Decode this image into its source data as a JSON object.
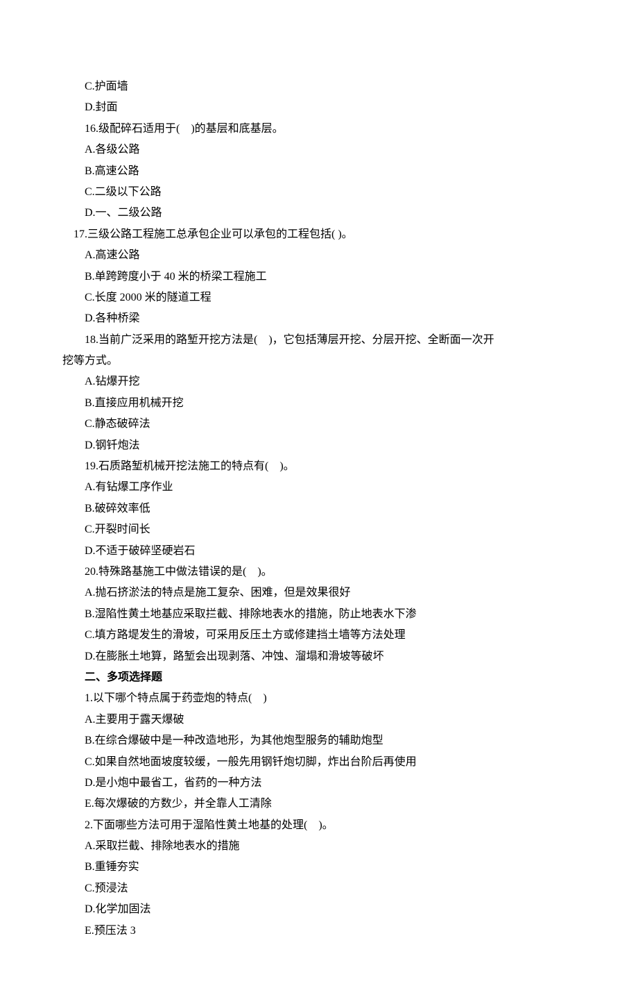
{
  "lines": [
    {
      "cls": "indent-2",
      "key": "q15_c",
      "text": "C.护面墙"
    },
    {
      "cls": "indent-2",
      "key": "q15_d",
      "text": "D.封面"
    },
    {
      "cls": "indent-2",
      "key": "q16_stem",
      "text": "16.级配碎石适用于(　)的基层和底基层。"
    },
    {
      "cls": "indent-2",
      "key": "q16_a",
      "text": "A.各级公路"
    },
    {
      "cls": "indent-2",
      "key": "q16_b",
      "text": "B.高速公路"
    },
    {
      "cls": "indent-2",
      "key": "q16_c",
      "text": "C.二级以下公路"
    },
    {
      "cls": "indent-2",
      "key": "q16_d",
      "text": "D.一、二级公路"
    },
    {
      "cls": "indent-1",
      "key": "q17_stem",
      "text": "17.三级公路工程施工总承包企业可以承包的工程包括( )。"
    },
    {
      "cls": "indent-2",
      "key": "q17_a",
      "text": "A.高速公路"
    },
    {
      "cls": "indent-2",
      "key": "q17_b",
      "text": "B.单跨跨度小于 40 米的桥梁工程施工"
    },
    {
      "cls": "indent-2",
      "key": "q17_c",
      "text": "C.长度 2000 米的隧道工程"
    },
    {
      "cls": "indent-2",
      "key": "q17_d",
      "text": "D.各种桥梁"
    },
    {
      "cls": "indent-2",
      "key": "q18_stem1",
      "text": "18.当前广泛采用的路堑开挖方法是(　)，它包括薄层开挖、分层开挖、全断面一次开"
    },
    {
      "cls": "no-indent",
      "key": "q18_stem2",
      "text": "挖等方式。"
    },
    {
      "cls": "indent-2",
      "key": "q18_a",
      "text": "A.钻爆开挖"
    },
    {
      "cls": "indent-2",
      "key": "q18_b",
      "text": "B.直接应用机械开挖"
    },
    {
      "cls": "indent-2",
      "key": "q18_c",
      "text": "C.静态破碎法"
    },
    {
      "cls": "indent-2",
      "key": "q18_d",
      "text": "D.钢钎炮法"
    },
    {
      "cls": "indent-2",
      "key": "q19_stem",
      "text": "19.石质路堑机械开挖法施工的特点有(　)。"
    },
    {
      "cls": "indent-2",
      "key": "q19_a",
      "text": "A.有钻爆工序作业"
    },
    {
      "cls": "indent-2",
      "key": "q19_b",
      "text": "B.破碎效率低"
    },
    {
      "cls": "indent-2",
      "key": "q19_c",
      "text": "C.开裂时间长"
    },
    {
      "cls": "indent-2",
      "key": "q19_d",
      "text": "D.不适于破碎坚硬岩石"
    },
    {
      "cls": "indent-2",
      "key": "q20_stem",
      "text": "20.特殊路基施工中做法错误的是(　)。"
    },
    {
      "cls": "indent-2",
      "key": "q20_a",
      "text": "A.抛石挤淤法的特点是施工复杂、困难，但是效果很好"
    },
    {
      "cls": "indent-2",
      "key": "q20_b",
      "text": "B.湿陷性黄土地基应采取拦截、排除地表水的措施，防止地表水下渗"
    },
    {
      "cls": "indent-2",
      "key": "q20_c",
      "text": "C.填方路堤发生的滑坡，可采用反压土方或修建挡土墙等方法处理"
    },
    {
      "cls": "indent-2",
      "key": "q20_d",
      "text": "D.在膨胀土地算，路堑会出现剥落、冲蚀、溜塌和滑坡等破坏"
    },
    {
      "cls": "indent-2 bold",
      "key": "section2",
      "text": "二、多项选择题"
    },
    {
      "cls": "indent-2",
      "key": "m1_stem",
      "text": "1.以下哪个特点属于药壶炮的特点(　)"
    },
    {
      "cls": "indent-2",
      "key": "m1_a",
      "text": "A.主要用于露天爆破"
    },
    {
      "cls": "indent-2",
      "key": "m1_b",
      "text": "B.在综合爆破中是一种改造地形，为其他炮型服务的辅助炮型"
    },
    {
      "cls": "indent-2",
      "key": "m1_c",
      "text": "C.如果自然地面坡度较缓，一般先用钢钎炮切脚，炸出台阶后再使用"
    },
    {
      "cls": "indent-2",
      "key": "m1_d",
      "text": "D.是小炮中最省工，省药的一种方法"
    },
    {
      "cls": "indent-2",
      "key": "m1_e",
      "text": "E.每次爆破的方数少，并全靠人工清除"
    },
    {
      "cls": "indent-2",
      "key": "m2_stem",
      "text": "2.下面哪些方法可用于湿陷性黄土地基的处理(　)。"
    },
    {
      "cls": "indent-2",
      "key": "m2_a",
      "text": "A.采取拦截、排除地表水的措施"
    },
    {
      "cls": "indent-2",
      "key": "m2_b",
      "text": "B.重锤夯实"
    },
    {
      "cls": "indent-2",
      "key": "m2_c",
      "text": "C.预浸法"
    },
    {
      "cls": "indent-2",
      "key": "m2_d",
      "text": "D.化学加固法"
    },
    {
      "cls": "indent-2",
      "key": "m2_e",
      "text": "E.预压法 3"
    }
  ]
}
